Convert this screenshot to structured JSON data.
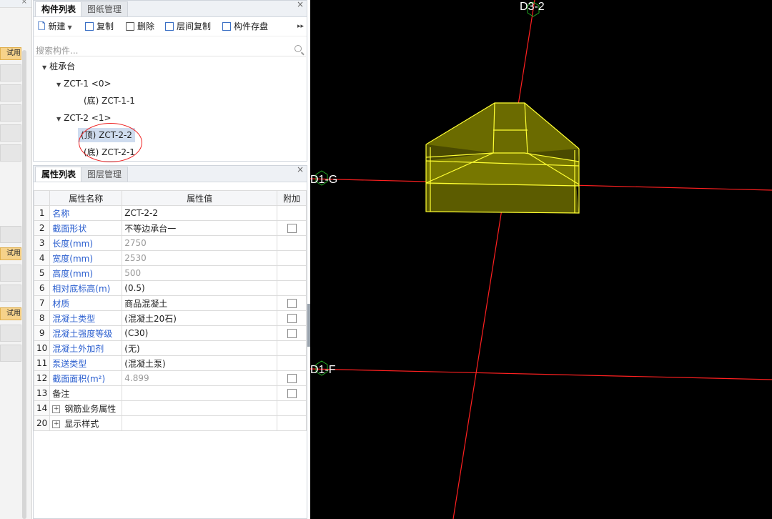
{
  "left_strip": {
    "buttons": [
      "试用",
      "试用",
      "试用"
    ],
    "close": "×"
  },
  "component_panel": {
    "tabs": [
      "构件列表",
      "图纸管理"
    ],
    "close": "×",
    "toolbar": {
      "new": "新建",
      "copy": "复制",
      "delete": "删除",
      "floor_copy": "层间复制",
      "save": "构件存盘",
      "more": "▸▸"
    },
    "search_placeholder": "搜索构件...",
    "tree": {
      "root": "桩承台",
      "groups": [
        {
          "label": "ZCT-1 <0>",
          "children": [
            "(底) ZCT-1-1"
          ]
        },
        {
          "label": "ZCT-2 <1>",
          "children": [
            "(顶) ZCT-2-2",
            "(底) ZCT-2-1"
          ]
        }
      ]
    },
    "annotation_color": "#e22222"
  },
  "property_panel": {
    "tabs": [
      "属性列表",
      "图层管理"
    ],
    "close": "×",
    "headers": [
      "",
      "属性名称",
      "属性值",
      "附加"
    ],
    "rows": [
      {
        "idx": "1",
        "name": "名称",
        "value": "ZCT-2-2",
        "name_color": "blue",
        "value_gray": false,
        "checkbox": false,
        "expand": false
      },
      {
        "idx": "2",
        "name": "截面形状",
        "value": "不等边承台一",
        "name_color": "blue",
        "value_gray": false,
        "checkbox": true,
        "expand": false
      },
      {
        "idx": "3",
        "name": "长度(mm)",
        "value": "2750",
        "name_color": "blue",
        "value_gray": true,
        "checkbox": false,
        "expand": false
      },
      {
        "idx": "4",
        "name": "宽度(mm)",
        "value": "2530",
        "name_color": "blue",
        "value_gray": true,
        "checkbox": false,
        "expand": false
      },
      {
        "idx": "5",
        "name": "高度(mm)",
        "value": "500",
        "name_color": "blue",
        "value_gray": true,
        "checkbox": false,
        "expand": false
      },
      {
        "idx": "6",
        "name": "相对底标高(m)",
        "value": "(0.5)",
        "name_color": "blue",
        "value_gray": false,
        "checkbox": false,
        "expand": false
      },
      {
        "idx": "7",
        "name": "材质",
        "value": "商品混凝土",
        "name_color": "blue",
        "value_gray": false,
        "checkbox": true,
        "expand": false
      },
      {
        "idx": "8",
        "name": "混凝土类型",
        "value": "(混凝土20石)",
        "name_color": "blue",
        "value_gray": false,
        "checkbox": true,
        "expand": false
      },
      {
        "idx": "9",
        "name": "混凝土强度等级",
        "value": "(C30)",
        "name_color": "blue",
        "value_gray": false,
        "checkbox": true,
        "expand": false
      },
      {
        "idx": "10",
        "name": "混凝土外加剂",
        "value": "(无)",
        "name_color": "blue",
        "value_gray": false,
        "checkbox": false,
        "expand": false
      },
      {
        "idx": "11",
        "name": "泵送类型",
        "value": "(混凝土泵)",
        "name_color": "blue",
        "value_gray": false,
        "checkbox": false,
        "expand": false
      },
      {
        "idx": "12",
        "name": "截面面积(m²)",
        "value": "4.899",
        "name_color": "blue",
        "value_gray": true,
        "checkbox": true,
        "expand": false
      },
      {
        "idx": "13",
        "name": "备注",
        "value": "",
        "name_color": "black",
        "value_gray": false,
        "checkbox": true,
        "expand": false
      },
      {
        "idx": "14",
        "name": "钢筋业务属性",
        "value": "",
        "name_color": "black",
        "value_gray": false,
        "checkbox": false,
        "expand": true
      },
      {
        "idx": "20",
        "name": "显示样式",
        "value": "",
        "name_color": "black",
        "value_gray": false,
        "checkbox": false,
        "expand": true
      }
    ]
  },
  "viewport": {
    "background": "#000000",
    "axis_color": "#ff2020",
    "solid_color": "#ffff33",
    "axes": [
      "D3-2",
      "D1-G",
      "D1-F"
    ]
  }
}
